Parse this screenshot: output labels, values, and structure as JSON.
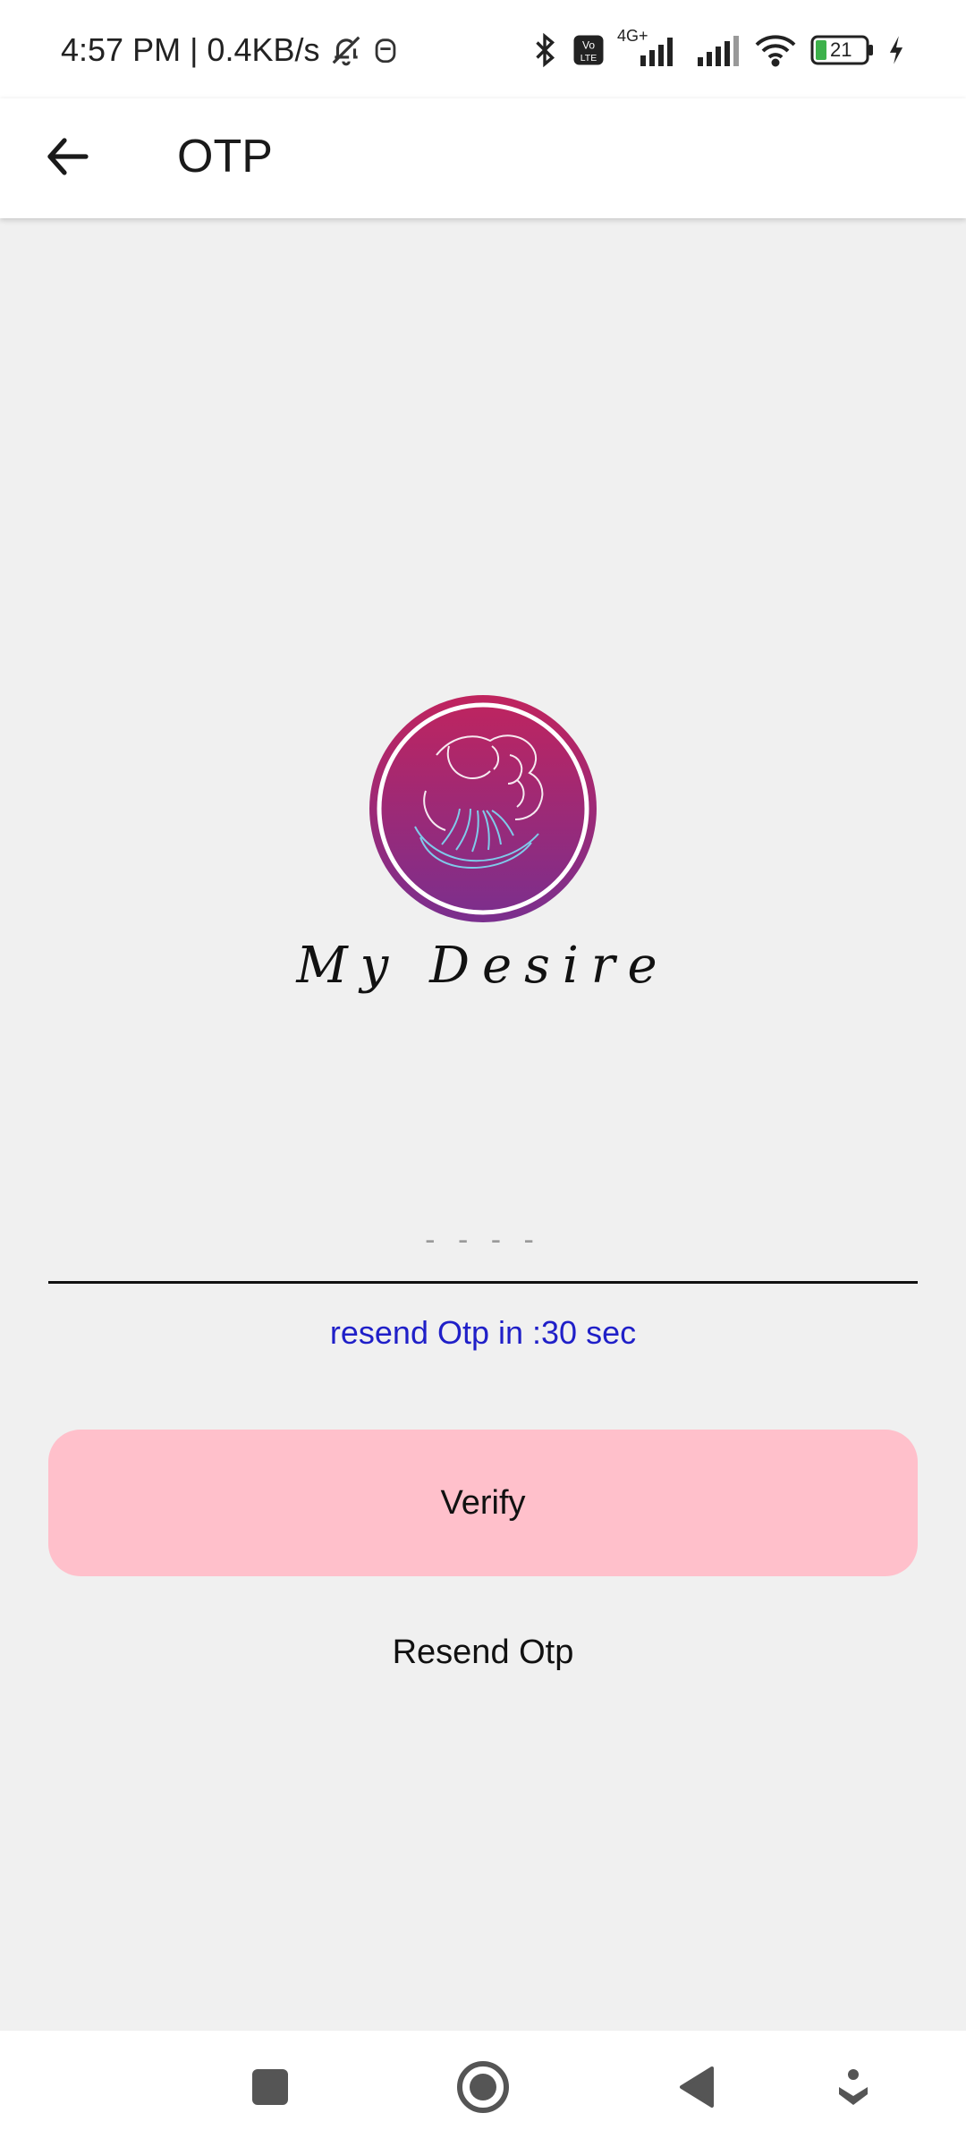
{
  "status_bar": {
    "time_speed": "4:57 PM | 0.4KB/s",
    "network_label": "4G+",
    "volte_label": "Vo LTE",
    "battery_level": "21"
  },
  "app_bar": {
    "title": "OTP"
  },
  "logo": {
    "brand_name": "My Desire",
    "colors": {
      "top": "#c0245e",
      "bottom": "#7a2f8e",
      "ring": "#ffffff"
    }
  },
  "otp": {
    "placeholder": "- - - -",
    "value": ""
  },
  "resend_timer": "resend Otp in :30 sec",
  "buttons": {
    "verify_label": "Verify",
    "resend_label": "Resend Otp"
  },
  "colors": {
    "verify_button_bg": "#ffc0cb",
    "timer_text": "#1f1fc8"
  },
  "icons": {
    "back": "arrow-left-icon",
    "nav_recents": "square-icon",
    "nav_home": "circle-icon",
    "nav_back": "triangle-icon",
    "nav_extra": "accessibility-icon"
  }
}
